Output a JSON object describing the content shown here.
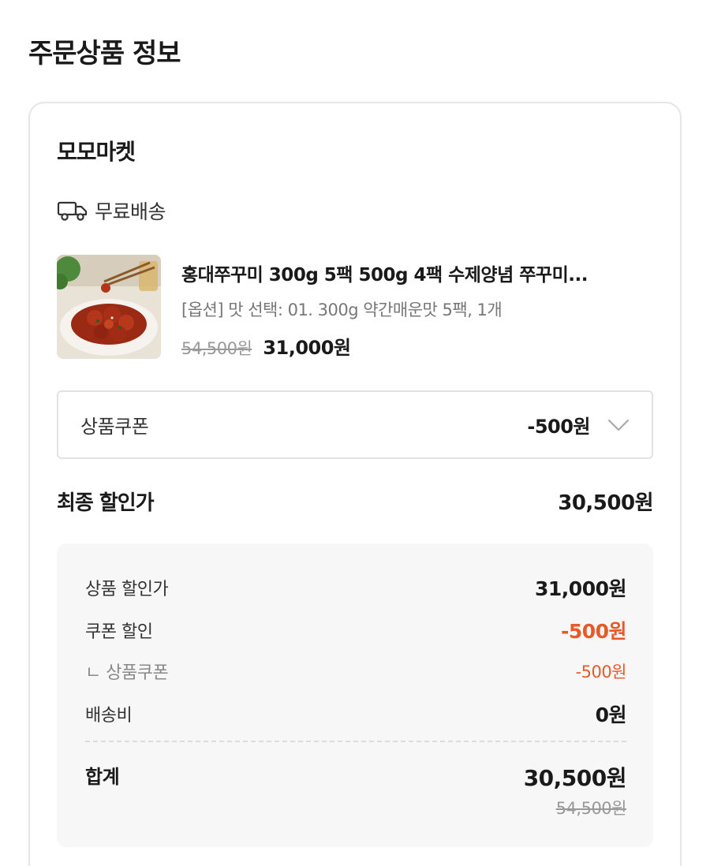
{
  "section": {
    "title": "주문상품 정보"
  },
  "seller": {
    "name": "모모마켓"
  },
  "shipping": {
    "icon": "truck-icon",
    "label": "무료배송"
  },
  "product": {
    "image": "product-thumbnail",
    "name": "홍대쭈꾸미 300g 5팩 500g 4팩 수제양념 쭈꾸미...",
    "option": "[옵션] 맛 선택: 01. 300g 약간매운맛 5팩, 1개",
    "original_price": "54,500원",
    "sale_price": "31,000원"
  },
  "coupon": {
    "label": "상품쿠폰",
    "value": "-500원",
    "icon": "chevron-down-icon"
  },
  "final": {
    "label": "최종 할인가",
    "value": "30,500원"
  },
  "summary": {
    "product_discount": {
      "label": "상품 할인가",
      "value": "31,000원"
    },
    "coupon_discount": {
      "label": "쿠폰 할인",
      "value": "-500원"
    },
    "coupon_sub": {
      "label": "ㄴ 상품쿠폰",
      "value": "-500원"
    },
    "shipping_fee": {
      "label": "배송비",
      "value": "0원"
    },
    "total": {
      "label": "합계",
      "value": "30,500원",
      "original": "54,500원"
    }
  },
  "colors": {
    "accent": "#e8592a",
    "text": "#1a1a1a",
    "muted": "#999999",
    "panel": "#f7f7f7"
  }
}
